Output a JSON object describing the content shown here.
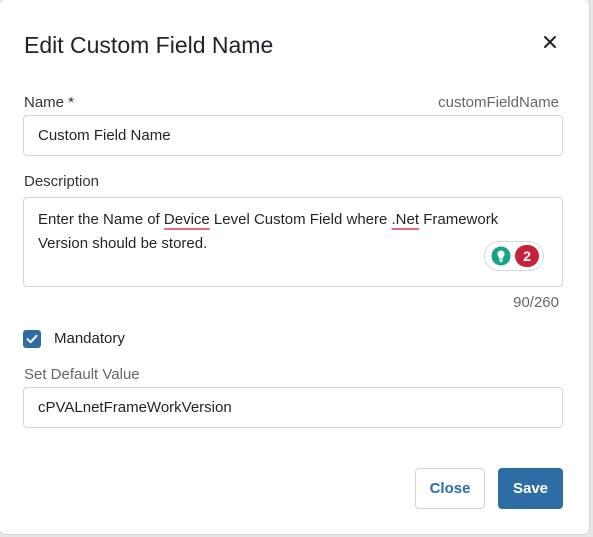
{
  "dialog": {
    "title": "Edit Custom Field Name",
    "close_icon": "close-icon"
  },
  "name_field": {
    "label": "Name *",
    "key_hint": "customFieldName",
    "value": "Custom Field Name"
  },
  "description_field": {
    "label": "Description",
    "text_parts": [
      "Enter the Name of ",
      "Device",
      " Level Custom Field where ",
      ".Net",
      " Framework Version should be stored."
    ],
    "counter": "90/260",
    "grammar_badge": {
      "icon": "lightbulb-icon",
      "count": "2"
    }
  },
  "mandatory": {
    "label": "Mandatory",
    "checked": true
  },
  "default_value_field": {
    "label": "Set Default Value",
    "value": "cPVALnetFrameWorkVersion"
  },
  "buttons": {
    "close_label": "Close",
    "save_label": "Save"
  },
  "colors": {
    "accent": "#2e6da4",
    "badge_red": "#c8213b",
    "spell_underline": "#e06b84"
  }
}
